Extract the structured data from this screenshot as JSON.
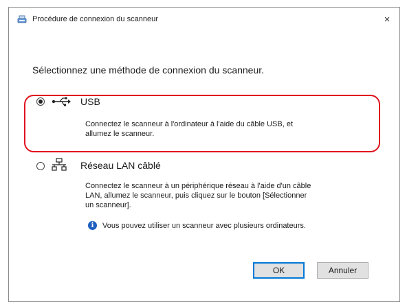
{
  "window": {
    "title": "Procédure de connexion du scanneur",
    "close_glyph": "×"
  },
  "prompt": "Sélectionnez une méthode de connexion du scanneur.",
  "options": [
    {
      "label": "USB",
      "selected": true,
      "icon": "usb-icon",
      "description_lines": [
        "Connectez le scanneur à l'ordinateur à l'aide du câble USB, et",
        "allumez le scanneur."
      ]
    },
    {
      "label": "Réseau LAN câblé",
      "selected": false,
      "icon": "wired-lan-icon",
      "description_lines": [
        "Connectez le scanneur à un périphérique réseau à l'aide d'un câble",
        "LAN, allumez le scanneur, puis cliquez sur le bouton [Sélectionner",
        "un scanneur]."
      ],
      "info": "Vous pouvez utiliser un scanneur avec plusieurs ordinateurs.",
      "info_icon": "i"
    }
  ],
  "buttons": {
    "ok": "OK",
    "cancel": "Annuler"
  },
  "colors": {
    "highlight": "#e0121e",
    "info": "#1f5fbf",
    "default_button_border": "#0078d7"
  }
}
